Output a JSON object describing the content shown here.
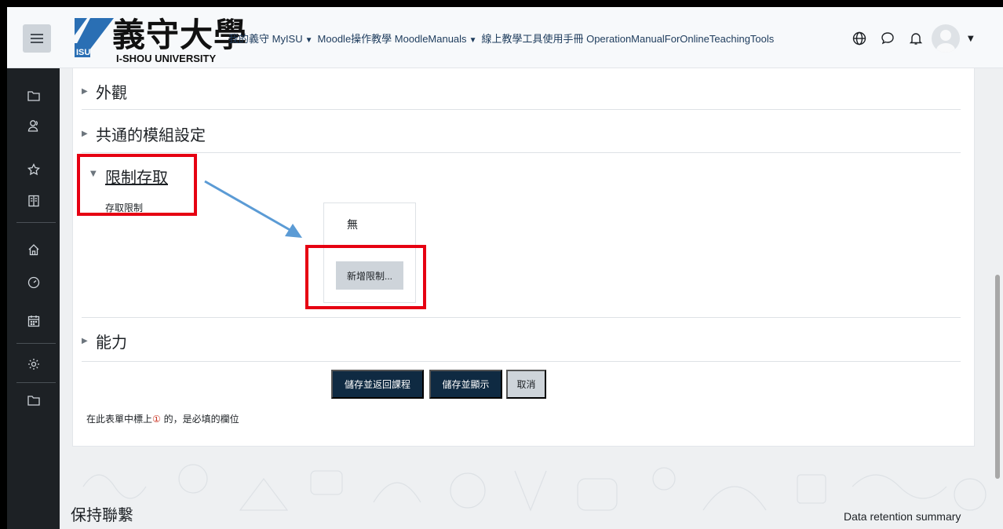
{
  "header": {
    "menu_icon": "hamburger-icon",
    "logo_cn": "義守大學",
    "logo_en": "I-SHOU UNIVERSITY",
    "logo_mark": "ISU",
    "nav": [
      {
        "label": "我的義守 MyISU",
        "has_caret": true
      },
      {
        "label": "Moodle操作教學 MoodleManuals",
        "has_caret": true
      },
      {
        "label": "線上教學工具使用手冊 OperationManualForOnlineTeachingTools",
        "has_caret": false
      }
    ],
    "icons": [
      "globe-icon",
      "chat-icon",
      "bell-icon",
      "avatar"
    ]
  },
  "drawer": {
    "icons": [
      "folder-icon",
      "participants-icon",
      "star-icon",
      "book-icon",
      "home-icon",
      "dashboard-icon",
      "calendar-icon",
      "gear-icon",
      "folder-icon"
    ]
  },
  "sections": {
    "appearance": "外觀",
    "common_modules": "共通的模組設定",
    "restrict_access": "限制存取",
    "restrict_label": "存取限制",
    "none": "無",
    "add_restriction": "新增限制...",
    "competencies": "能力"
  },
  "buttons": {
    "save_return": "儲存並返回課程",
    "save_display": "儲存並顯示",
    "cancel": "取消"
  },
  "required_note": {
    "prefix": "在此表單中標上",
    "mark": "①",
    "suffix": " 的，是必填的欄位"
  },
  "footer": {
    "title": "保持聯繫",
    "data_retention": "Data retention summary"
  },
  "colors": {
    "annotation_red": "#e60012",
    "annotation_arrow": "#5b9bd5",
    "primary_button": "#0f2a42",
    "drawer_bg": "#1d2125"
  }
}
